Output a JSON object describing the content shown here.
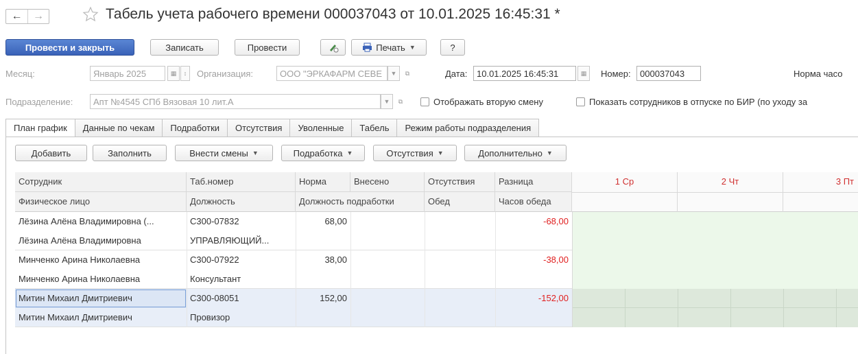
{
  "window": {
    "title": "Табель учета рабочего времени 000037043 от 10.01.2025 16:45:31 *",
    "back_icon": "arrow-left-icon",
    "forward_icon": "arrow-right-icon",
    "favorite_icon": "star-icon"
  },
  "toolbar": {
    "post_close": "Провести и закрыть",
    "save": "Записать",
    "post": "Провести",
    "print": "Печать",
    "help": "?"
  },
  "header_fields": {
    "month_label": "Месяц:",
    "month_value": "Январь 2025",
    "org_label": "Организация:",
    "org_value": "ООО \"ЭРКАФАРМ СЕВЕ",
    "date_label": "Дата:",
    "date_value": "10.01.2025 16:45:31",
    "number_label": "Номер:",
    "number_value": "000037043",
    "norm_label": "Норма часо",
    "dept_label": "Подразделение:",
    "dept_value": "Апт №4545 СПб Вязовая 10 лит.А",
    "second_shift_label": "Отображать вторую смену",
    "vacation_label": "Показать сотрудников в отпуске по БИР (по уходу за"
  },
  "tabs": [
    {
      "label": "План график",
      "active": true
    },
    {
      "label": "Данные по чекам",
      "active": false
    },
    {
      "label": "Подработки",
      "active": false
    },
    {
      "label": "Отсутствия",
      "active": false
    },
    {
      "label": "Уволенные",
      "active": false
    },
    {
      "label": "Табель",
      "active": false
    },
    {
      "label": "Режим работы подразделения",
      "active": false
    }
  ],
  "grid_toolbar": {
    "add": "Добавить",
    "fill": "Заполнить",
    "shifts": "Внести смены",
    "extra": "Подработка",
    "absences": "Отсутствия",
    "more": "Дополнительно"
  },
  "columns": {
    "employee": "Сотрудник",
    "person": "Физическое лицо",
    "tab_no": "Таб.номер",
    "position": "Должность",
    "norm": "Норма",
    "entered": "Внесено",
    "extra_position": "Должность подработки",
    "absences": "Отсутствия",
    "lunch": "Обед",
    "diff": "Разница",
    "lunch_hours": "Часов обеда",
    "day1": "1 Ср",
    "day2": "2 Чт",
    "day3": "3 Пт"
  },
  "rows": [
    {
      "employee": "Лёзина Алёна Владимировна (...",
      "person": "Лёзина Алёна Владимировна",
      "tab_no": "С300-07832",
      "position": "УПРАВЛЯЮЩИЙ...",
      "norm": "68,00",
      "diff": "-68,00"
    },
    {
      "employee": "Минченко Арина Николаевна",
      "person": "Минченко Арина Николаевна",
      "tab_no": "С300-07922",
      "position": "Консультант",
      "norm": "38,00",
      "diff": "-38,00"
    },
    {
      "employee": "Митин Михаил Дмитриевич",
      "person": "Митин Михаил Дмитриевич",
      "tab_no": "С300-08051",
      "position": "Провизор",
      "norm": "152,00",
      "diff": "-152,00"
    }
  ],
  "colors": {
    "primary_button": "#3a62b8",
    "negative": "#e02020",
    "day_header": "#d03030",
    "day_zone": "#ecf8ea",
    "selected_day_zone": "#dde8db",
    "selected_row": "#e8eef8"
  }
}
